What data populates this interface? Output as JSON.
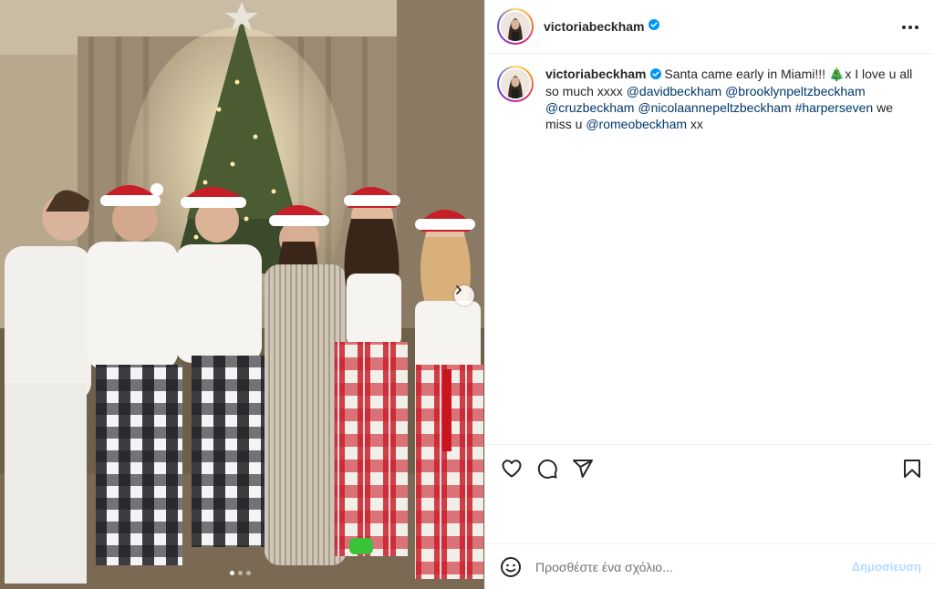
{
  "post": {
    "username": "victoriabeckham",
    "verified": true,
    "photo_description_icon": "family-christmas-photo",
    "carousel": {
      "total": 3,
      "active": 1
    }
  },
  "caption": {
    "username": "victoriabeckham",
    "text_before": "Santa came early in Miami!!! ",
    "emoji": "🎄",
    "text_after_emoji": "x I love u all so much xxxx ",
    "tags": [
      "@davidbeckham",
      "@brooklynpeltzbeckham",
      "@cruzbeckham",
      "@nicolaannepeltzbeckham",
      "#harperseven"
    ],
    "text_middle": " we miss u ",
    "tag_last": "@romeobeckham",
    "text_end": " xx"
  },
  "comment": {
    "placeholder": "Προσθέστε ένα σχόλιο...",
    "post_label": "Δημοσίευση"
  },
  "colors": {
    "link": "#00376b",
    "verified": "#0095f6",
    "post_disabled": "#b3dbff"
  },
  "icons": [
    "heart-icon",
    "comment-icon",
    "share-icon",
    "bookmark-icon",
    "emoji-icon",
    "more-icon",
    "chevron-right-icon",
    "verified-icon"
  ]
}
